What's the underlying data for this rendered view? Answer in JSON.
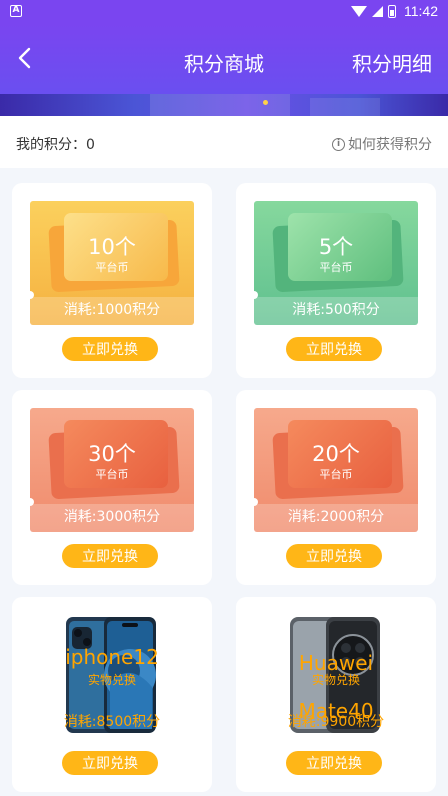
{
  "status_bar": {
    "time": "11:42",
    "app_icon": "A"
  },
  "header": {
    "back_icon": "chevron-left-icon",
    "title": "积分商城",
    "detail_link": "积分明细"
  },
  "points": {
    "label": "我的积分：0",
    "help_link": "如何获得积分",
    "help_icon": "info-icon"
  },
  "coupon_cards": [
    {
      "amount": "10个",
      "unit": "平台币",
      "cost": "消耗:1000积分",
      "button": "立即兑换",
      "color": "#f7b84a"
    },
    {
      "amount": "5个",
      "unit": "平台币",
      "cost": "消耗:500积分",
      "button": "立即兑换",
      "color": "#6ec895"
    },
    {
      "amount": "30个",
      "unit": "平台币",
      "cost": "消耗:3000积分",
      "button": "立即兑换",
      "color": "#f29a7a"
    },
    {
      "amount": "20个",
      "unit": "平台币",
      "cost": "消耗:2000积分",
      "button": "立即兑换",
      "color": "#f29a7a"
    }
  ],
  "product_cards": [
    {
      "name": "iphone12",
      "tag": "实物兑换",
      "cost": "消耗:8500积分",
      "button": "立即兑换",
      "image": "iphone12-image"
    },
    {
      "name": "Huawei Mate40",
      "tag": "实物兑换",
      "cost": "消耗:9900积分",
      "button": "立即兑换",
      "image": "huawei-mate40-image"
    }
  ],
  "colors": {
    "header": "#7a45f0",
    "button": "#ffb617",
    "product_text": "#ffa500"
  }
}
